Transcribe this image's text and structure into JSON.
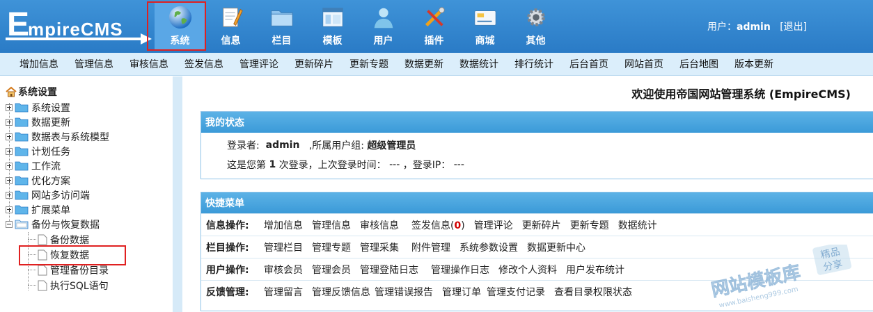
{
  "brand": {
    "logo_e": "E",
    "logo_rest": "mpireCMS"
  },
  "nav": [
    {
      "label": "系统",
      "icon": "globe-icon"
    },
    {
      "label": "信息",
      "icon": "notepad-icon"
    },
    {
      "label": "栏目",
      "icon": "folder-icon"
    },
    {
      "label": "模板",
      "icon": "window-template-icon"
    },
    {
      "label": "用户",
      "icon": "user-icon"
    },
    {
      "label": "插件",
      "icon": "tools-icon"
    },
    {
      "label": "商城",
      "icon": "card-icon"
    },
    {
      "label": "其他",
      "icon": "gear-icon"
    }
  ],
  "user": {
    "prefix": "用户：",
    "name": "admin",
    "logout": "[退出]"
  },
  "submenu": [
    "增加信息",
    "管理信息",
    "审核信息",
    "签发信息",
    "管理评论",
    "更新碎片",
    "更新专题",
    "数据更新",
    "数据统计",
    "排行统计",
    "后台首页",
    "网站首页",
    "后台地图",
    "版本更新"
  ],
  "tree": {
    "root": "系统设置",
    "nodes": [
      "系统设置",
      "数据更新",
      "数据表与系统模型",
      "计划任务",
      "工作流",
      "优化方案",
      "网站多访问端",
      "扩展菜单",
      "备份与恢复数据"
    ],
    "leaves": [
      "备份数据",
      "恢复数据",
      "管理备份目录",
      "执行SQL语句"
    ]
  },
  "welcome": "欢迎使用帝国网站管理系统 (EmpireCMS)",
  "status": {
    "title": "我的状态",
    "login_label": "登录者:",
    "login_user": "admin",
    "group_label": ",所属用户组:",
    "group": "超级管理员",
    "count_prefix": "这是您第",
    "count": "1",
    "count_suffix": "次登录，上次登录时间：",
    "last_time": "---",
    "ip_label": "，登录IP：",
    "ip": "---"
  },
  "quick": {
    "title": "快捷菜单",
    "rows": [
      {
        "label": "信息操作:",
        "links": [
          "增加信息",
          "管理信息",
          "审核信息"
        ],
        "sign_prefix": "签发信息(",
        "sign_count": "0",
        "sign_suffix": ")",
        "more": [
          "管理评论",
          "更新碎片",
          "更新专题",
          "数据统计"
        ]
      },
      {
        "label": "栏目操作:",
        "links": [
          "管理栏目",
          "管理专题",
          "管理采集",
          "附件管理",
          "系统参数设置",
          "数据更新中心"
        ]
      },
      {
        "label": "用户操作:",
        "links": [
          "审核会员",
          "管理会员",
          "管理登陆日志",
          "管理操作日志",
          "修改个人资料",
          "用户发布统计"
        ]
      },
      {
        "label": "反馈管理:",
        "links": [
          "管理留言",
          "管理反馈信息",
          "管理错误报告",
          "管理订单",
          "管理支付记录",
          "查看目录权限状态"
        ]
      }
    ]
  },
  "watermark": {
    "main": "网站模板库",
    "url": "www.baisheng999.com",
    "badge1": "精品",
    "badge2": "分享"
  }
}
